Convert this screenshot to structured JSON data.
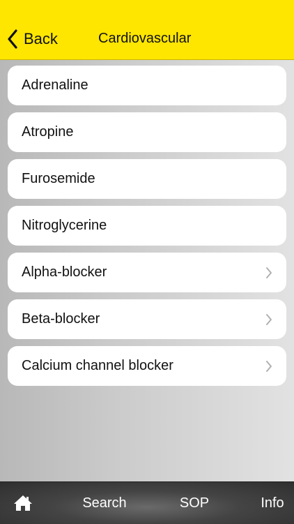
{
  "header": {
    "back_label": "Back",
    "title": "Cardiovascular",
    "background_color": "#ffe600"
  },
  "list": {
    "items": [
      {
        "label": "Adrenaline",
        "has_chevron": false
      },
      {
        "label": "Atropine",
        "has_chevron": false
      },
      {
        "label": "Furosemide",
        "has_chevron": false
      },
      {
        "label": "Nitroglycerine",
        "has_chevron": false
      },
      {
        "label": "Alpha-blocker",
        "has_chevron": true
      },
      {
        "label": "Beta-blocker",
        "has_chevron": true
      },
      {
        "label": "Calcium channel blocker",
        "has_chevron": true
      }
    ]
  },
  "tabbar": {
    "home_icon": "home-icon",
    "search_label": "Search",
    "sop_label": "SOP",
    "info_label": "Info"
  }
}
